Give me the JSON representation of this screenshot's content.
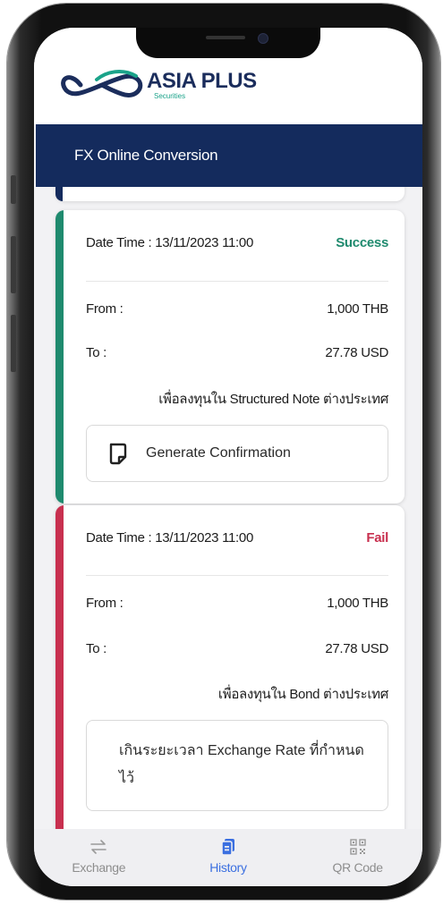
{
  "brand": {
    "name": "ASIA PLUS",
    "subtitle": "Securities"
  },
  "header": {
    "title": "FX Online Conversion"
  },
  "transactions": [
    {
      "datetime": "Date Time : 13/11/2023 11:00",
      "status": "Success",
      "from_label": "From :",
      "from_value": "1,000 THB",
      "to_label": "To :",
      "to_value": "27.78 USD",
      "purpose": "เพื่อลงทุนใน Structured Note ต่างประเทศ",
      "action_label": "Generate Confirmation"
    },
    {
      "datetime": "Date Time : 13/11/2023 11:00",
      "status": "Fail",
      "from_label": "From :",
      "from_value": "1,000 THB",
      "to_label": "To :",
      "to_value": "27.78 USD",
      "purpose": "เพื่อลงทุนใน Bond ต่างประเทศ",
      "reason": "เกินระยะเวลา Exchange Rate ที่กำหนดไว้"
    }
  ],
  "tabs": [
    {
      "label": "Exchange",
      "icon": "exchange-icon"
    },
    {
      "label": "History",
      "icon": "history-icon"
    },
    {
      "label": "QR Code",
      "icon": "qr-code-icon"
    }
  ],
  "active_tab": "History",
  "colors": {
    "navy": "#142b5d",
    "success": "#1f8a6e",
    "fail": "#c8304f",
    "active_tab": "#3b6fe0",
    "accent_teal": "#1ba38a"
  }
}
